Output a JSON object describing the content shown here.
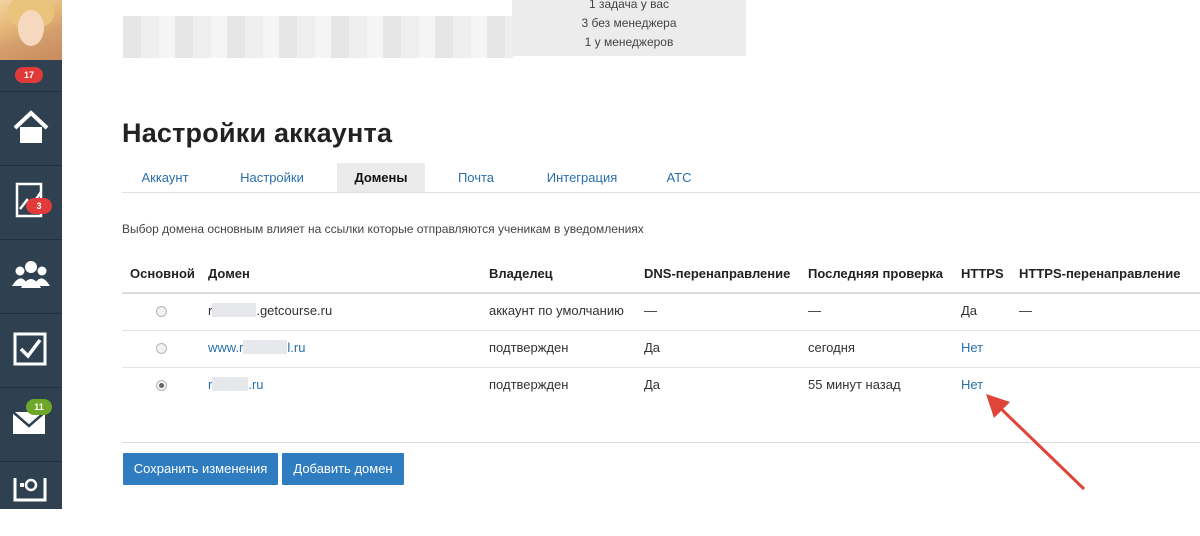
{
  "sidebar": {
    "avatar_badge": "17",
    "items": [
      {
        "icon": "home-icon",
        "badge": ""
      },
      {
        "icon": "chart-icon",
        "badge": "3"
      },
      {
        "icon": "users-icon",
        "badge": ""
      },
      {
        "icon": "checkbox-icon",
        "badge": ""
      },
      {
        "icon": "mail-icon",
        "badge": "11"
      },
      {
        "icon": "safe-icon",
        "badge": ""
      }
    ]
  },
  "top_stats": {
    "line1": "1 задача у вас",
    "line2": "3 без менеджера",
    "line3": "1 у менеджеров"
  },
  "page_title": "Настройки аккаунта",
  "tabs": [
    {
      "label": "Аккаунт",
      "active": false
    },
    {
      "label": "Настройки",
      "active": false
    },
    {
      "label": "Домены",
      "active": true
    },
    {
      "label": "Почта",
      "active": false
    },
    {
      "label": "Интеграция",
      "active": false
    },
    {
      "label": "АТС",
      "active": false
    }
  ],
  "description": "Выбор домена основным влияет на ссылки которые отправляются ученикам в уведомлениях",
  "table": {
    "headers": [
      "Основной",
      "Домен",
      "Владелец",
      "DNS-перенаправление",
      "Последняя проверка",
      "HTTPS",
      "HTTPS-перенаправление"
    ],
    "rows": [
      {
        "primary": false,
        "domain_prefix": "r",
        "domain_suffix": ".getcourse.ru",
        "owner": "аккаунт по умолчанию",
        "dns": "—",
        "last_check": "—",
        "https": "Да",
        "https_redirect": "—"
      },
      {
        "primary": false,
        "domain_prefix": "www.r",
        "domain_suffix": "l.ru",
        "owner": "подтвержден",
        "dns": "Да",
        "last_check": "сегодня",
        "https": "Нет",
        "https_redirect": ""
      },
      {
        "primary": true,
        "domain_prefix": "r",
        "domain_suffix": ".ru",
        "owner": "подтвержден",
        "dns": "Да",
        "last_check": "55 минут назад",
        "https": "Нет",
        "https_redirect": ""
      }
    ]
  },
  "buttons": {
    "save": "Сохранить изменения",
    "add_domain": "Добавить домен"
  },
  "colors": {
    "accent": "#2f7cc0",
    "sidebar": "#2f4050",
    "arrow": "#e0453a"
  }
}
